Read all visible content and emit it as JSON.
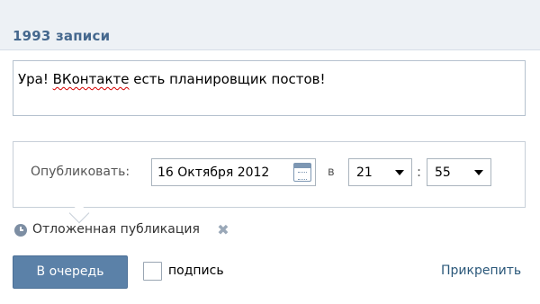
{
  "header": {
    "title": "1993 записи"
  },
  "post": {
    "text_before": "Ура! ",
    "text_misspelled": "ВКонтакте",
    "text_after": " есть планировщик постов!"
  },
  "schedule": {
    "publish_label": "Опубликовать:",
    "date": "16 Октября 2012",
    "at_label": "в",
    "hour": "21",
    "colon": ":",
    "minute": "55"
  },
  "deferred": {
    "label": "Отложенная публикация",
    "remove_icon": "✖"
  },
  "actions": {
    "queue_button": "В очередь",
    "signature_label": "подпись",
    "signature_checked": false,
    "attach_link": "Прикрепить"
  }
}
